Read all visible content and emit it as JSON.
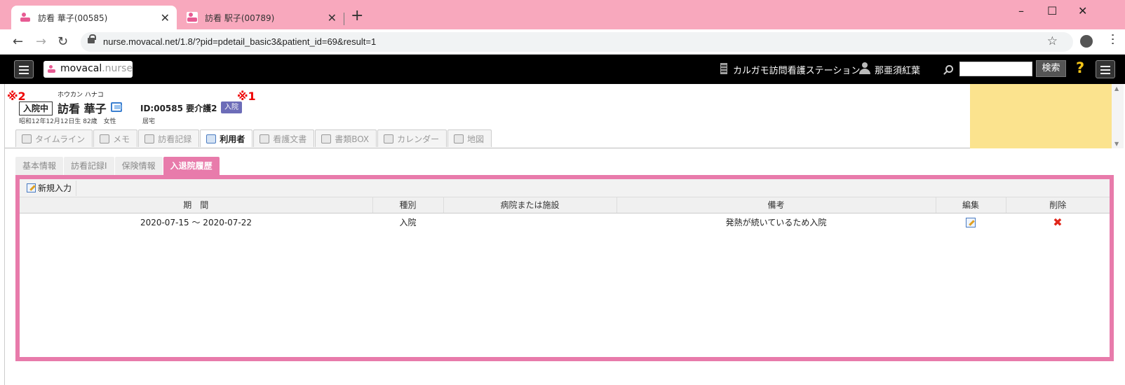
{
  "browser": {
    "tabs": [
      {
        "title": "訪看 華子(00585)",
        "active": true
      },
      {
        "title": "訪看 駅子(00789)",
        "active": false
      }
    ],
    "close_glyph": "✕",
    "new_tab_glyph": "+",
    "window_controls": [
      "–",
      "☐",
      "✕"
    ],
    "url": "nurse.movacal.net/1.8/?pid=pdetail_basic3&patient_id=69&result=1",
    "nav": {
      "back": "←",
      "forward": "→",
      "reload": "↻"
    },
    "star": "☆"
  },
  "header": {
    "logo_main": "movacal",
    "logo_sub": ".nurse",
    "station": "カルガモ訪問看護ステーション",
    "user": "那亜須紅葉",
    "search_button": "検索",
    "search_value": "",
    "help": "?"
  },
  "patient": {
    "annotation_1": "※1",
    "annotation_2": "※2",
    "status": "入院中",
    "kana": "ホウカン ハナコ",
    "name": "訪看 華子",
    "id_care": "ID:00585 要介護2",
    "admit_badge": "入院",
    "info": "昭和12年12月12日生 82歳　女性",
    "place": "居宅"
  },
  "nav_tabs": [
    {
      "label": "タイムライン",
      "icon": "timeline-icon",
      "active": false
    },
    {
      "label": "メモ",
      "icon": "pencil-icon",
      "active": false
    },
    {
      "label": "訪看記録",
      "icon": "record-icon",
      "active": false
    },
    {
      "label": "利用者",
      "icon": "id-card-icon",
      "active": true
    },
    {
      "label": "看護文書",
      "icon": "pdf-icon",
      "active": false
    },
    {
      "label": "書類BOX",
      "icon": "box-icon",
      "active": false
    },
    {
      "label": "カレンダー",
      "icon": "calendar-icon",
      "active": false
    },
    {
      "label": "地図",
      "icon": "map-icon",
      "active": false
    }
  ],
  "sub_tabs": [
    {
      "label": "基本情報",
      "active": false
    },
    {
      "label": "訪看記録I",
      "active": false
    },
    {
      "label": "保険情報",
      "active": false
    },
    {
      "label": "入退院履歴",
      "active": true
    }
  ],
  "toolbar": {
    "new_entry": "新規入力"
  },
  "table": {
    "headers": [
      "期　間",
      "種別",
      "病院または施設",
      "備考",
      "編集",
      "削除"
    ],
    "rows": [
      {
        "period": "2020-07-15 ～ 2020-07-22",
        "type": "入院",
        "facility": "",
        "note": "発熱が続いているため入院",
        "delete_glyph": "✖"
      }
    ]
  },
  "colors": {
    "tab_strip": "#f8a8bd",
    "accent_pink": "#e87bab",
    "badge": "#6c6cb8",
    "yellow_panel": "#fbe38e",
    "annotation_red": "#ee0000"
  }
}
